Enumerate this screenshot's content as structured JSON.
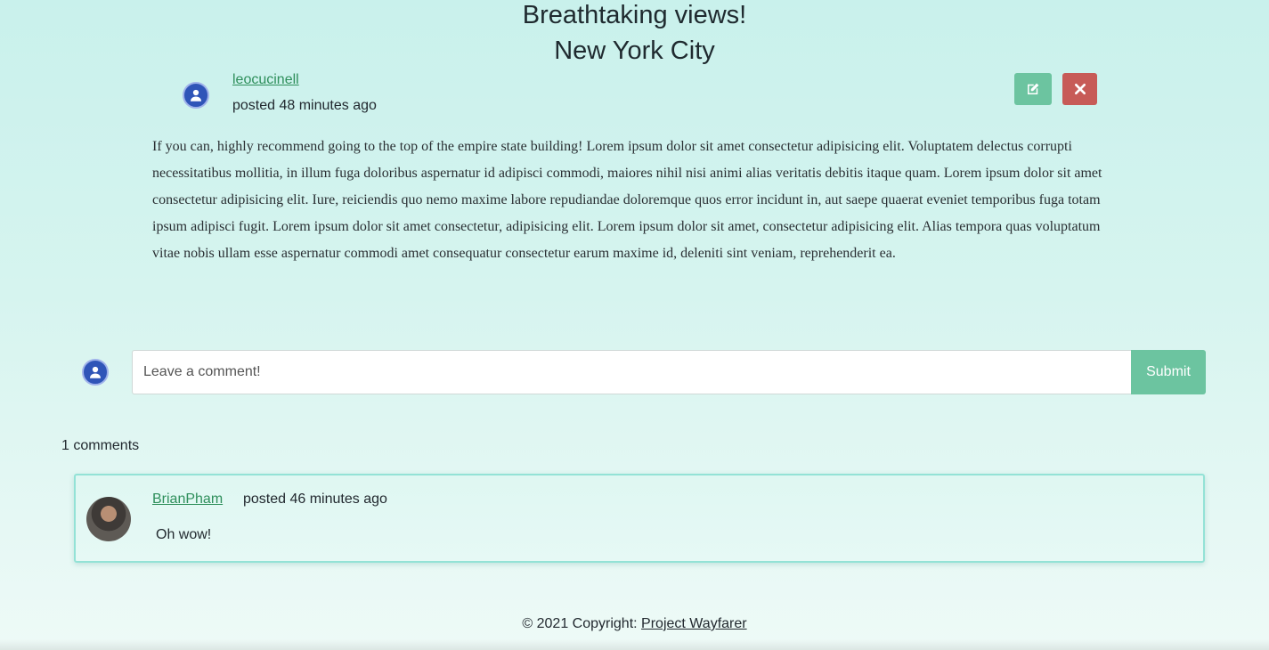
{
  "post": {
    "title": "Breathtaking views!",
    "city": "New York City",
    "author": "leocucinell",
    "posted": "posted 48 minutes ago",
    "body": "If you can, highly recommend going to the top of the empire state building! Lorem ipsum dolor sit amet consectetur adipisicing elit. Voluptatem delectus corrupti necessitatibus mollitia, in illum fuga doloribus aspernatur id adipisci commodi, maiores nihil nisi animi alias veritatis debitis itaque quam. Lorem ipsum dolor sit amet consectetur adipisicing elit. Iure, reiciendis quo nemo maxime labore repudiandae doloremque quos error incidunt in, aut saepe quaerat eveniet temporibus fuga totam ipsum adipisci fugit. Lorem ipsum dolor sit amet consectetur, adipisicing elit. Lorem ipsum dolor sit amet, consectetur adipisicing elit. Alias tempora quas voluptatum vitae nobis ullam esse aspernatur commodi amet consequatur consectetur earum maxime id, deleniti sint veniam, reprehenderit ea."
  },
  "actions": {
    "edit_icon": "edit-icon",
    "delete_icon": "close-icon",
    "edit_color": "#6cc4a0",
    "delete_color": "#c75b57"
  },
  "comment_form": {
    "placeholder": "Leave a comment!",
    "submit_label": "Submit"
  },
  "comments": {
    "count_label": "1 comments",
    "items": [
      {
        "author": "BrianPham",
        "posted": "posted 46 minutes ago",
        "text": "Oh wow!"
      }
    ]
  },
  "footer": {
    "prefix": "© 2021 Copyright:",
    "link": "Project Wayfarer"
  }
}
